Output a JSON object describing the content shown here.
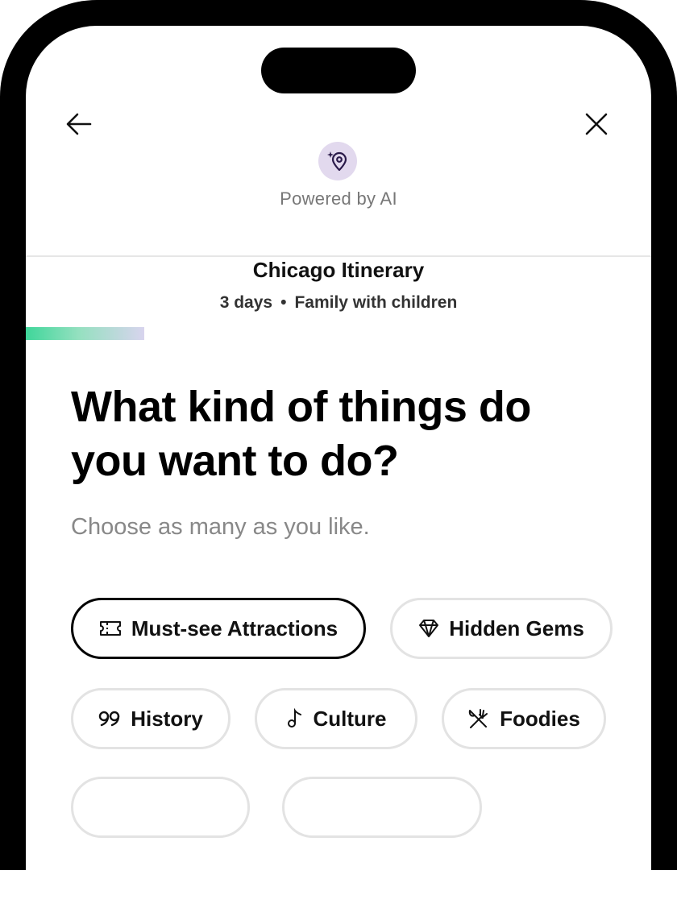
{
  "header": {
    "back_icon": "arrow-left-icon",
    "close_icon": "close-icon",
    "ai_icon": "sparkle-location-pin-icon",
    "powered_label": "Powered by AI",
    "accent_color": "#e2d9ee"
  },
  "trip": {
    "title": "Chicago Itinerary",
    "duration": "3 days",
    "separator": "•",
    "group": "Family with children"
  },
  "progress": {
    "fraction": 0.19,
    "colors": [
      "#3fd69a",
      "#d8d4ee"
    ]
  },
  "question": {
    "title": "What kind of things do you want to do?",
    "subtitle": "Choose as many as you like."
  },
  "options": [
    {
      "label": "Must-see Attractions",
      "icon": "ticket-icon",
      "selected": true
    },
    {
      "label": "Hidden Gems",
      "icon": "diamond-icon",
      "selected": false
    },
    {
      "label": "History",
      "icon": "quote-icon",
      "selected": false
    },
    {
      "label": "Culture",
      "icon": "music-note-icon",
      "selected": false
    },
    {
      "label": "Foodies",
      "icon": "utensils-icon",
      "selected": false
    }
  ]
}
